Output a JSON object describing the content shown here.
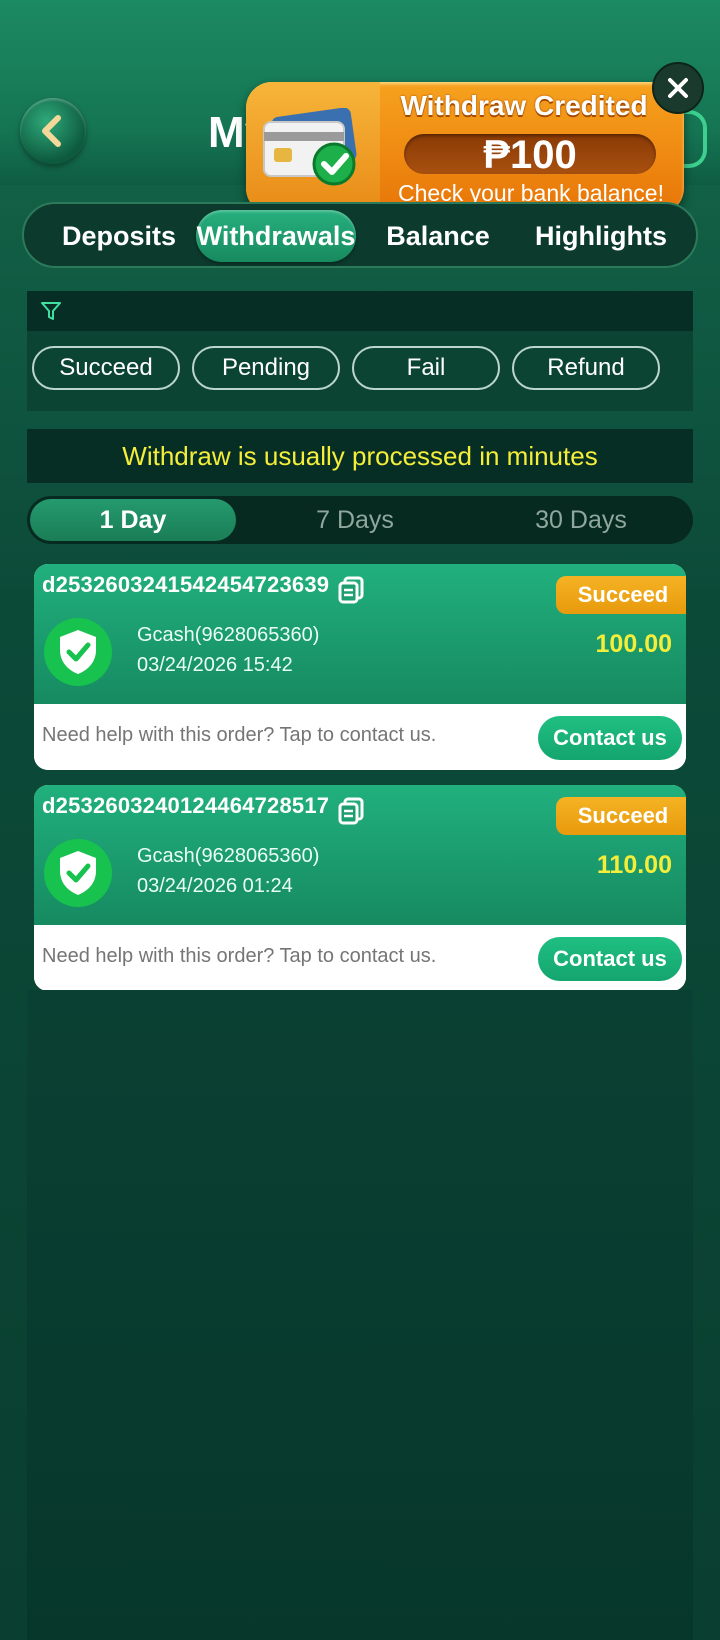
{
  "header": {
    "title": "My"
  },
  "toast": {
    "title": "Withdraw Credited",
    "amount": "₱100",
    "subtitle": "Check your bank balance!"
  },
  "main_tabs": [
    {
      "label": "Deposits",
      "active": false
    },
    {
      "label": "Withdrawals",
      "active": true
    },
    {
      "label": "Balance",
      "active": false
    },
    {
      "label": "Highlights",
      "active": false
    }
  ],
  "filters": {
    "chips": [
      "Succeed",
      "Pending",
      "Fail",
      "Refund"
    ]
  },
  "notice": "Withdraw is usually processed in minutes",
  "day_tabs": [
    {
      "label": "1 Day",
      "active": true
    },
    {
      "label": "7 Days",
      "active": false
    },
    {
      "label": "30 Days",
      "active": false
    }
  ],
  "orders": [
    {
      "id": "d2532603241542454723639",
      "status": "Succeed",
      "method": "Gcash(9628065360)",
      "datetime": "03/24/2026 15:42",
      "amount": "100.00",
      "help": "Need help with this order? Tap to contact us.",
      "contact": "Contact us"
    },
    {
      "id": "d2532603240124464728517",
      "status": "Succeed",
      "method": "Gcash(9628065360)",
      "datetime": "03/24/2026 01:24",
      "amount": "110.00",
      "help": "Need help with this order? Tap to contact us.",
      "contact": "Contact us"
    }
  ],
  "colors": {
    "accent_green": "#1fb07e",
    "highlight_yellow": "#f4ee3a",
    "badge_orange": "#f5b324",
    "toast_orange": "#ef8a12"
  },
  "icons": {
    "back": "chevron-left-icon",
    "close": "close-icon",
    "filter": "filter-icon",
    "copy": "copy-icon",
    "verified": "shield-check-icon"
  }
}
